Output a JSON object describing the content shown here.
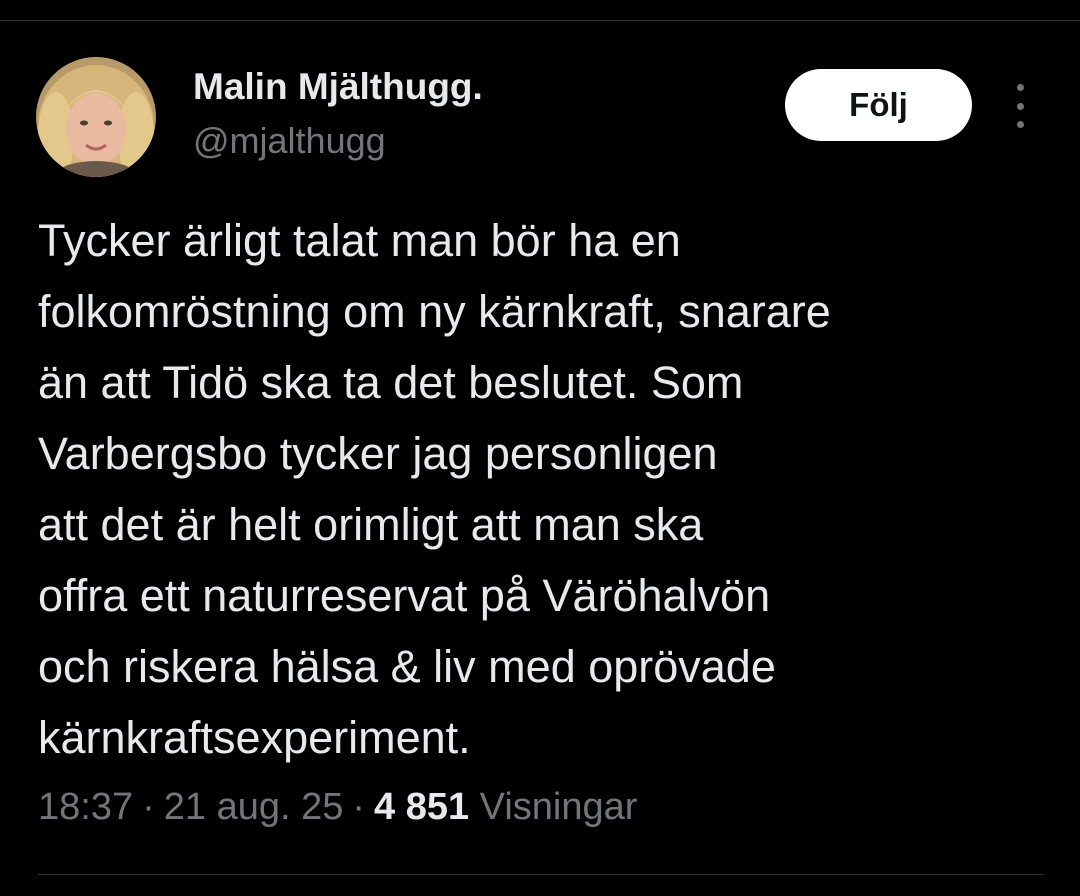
{
  "author": {
    "name": "Malin Mjälthugg.",
    "handle": "@mjalthugg"
  },
  "actions": {
    "follow_label": "Följ"
  },
  "tweet": {
    "lines": [
      "Tycker ärligt talat man bör ha en",
      "folkomröstning om ny kärnkraft, snarare",
      "än att Tidö ska ta det beslutet. Som",
      "Varbergsbo tycker jag personligen",
      "att det är helt orimligt att man ska",
      "offra ett naturreservat på Väröhalvön",
      "och riskera hälsa & liv med oprövade",
      "kärnkraftsexperiment."
    ]
  },
  "meta": {
    "time": "18:37",
    "separator": "·",
    "date": "21 aug. 25",
    "views_count": "4 851",
    "views_label": "Visningar"
  },
  "icons": {
    "more": "more-vertical-icon"
  },
  "colors": {
    "background": "#000000",
    "text_primary": "#e7e9ea",
    "text_secondary": "#71767b",
    "follow_button_bg": "#ffffff",
    "follow_button_text": "#0f1419",
    "divider": "#2f3336"
  }
}
